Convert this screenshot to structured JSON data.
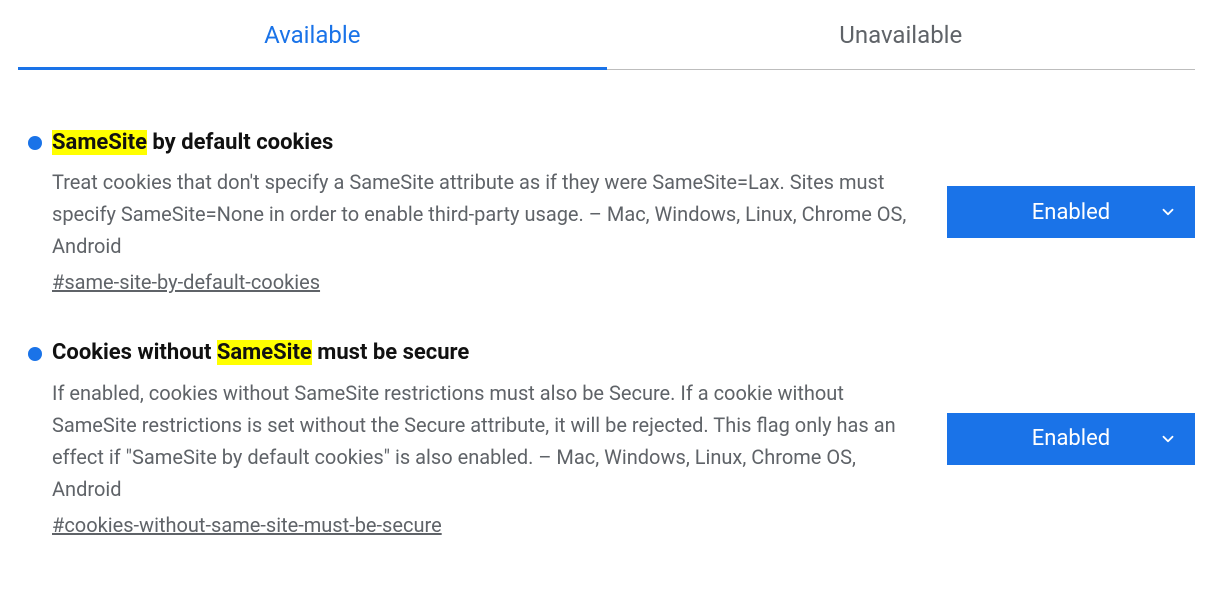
{
  "tabs": {
    "available": "Available",
    "unavailable": "Unavailable"
  },
  "highlight": "SameSite",
  "flags": [
    {
      "title_before": "",
      "title_highlight": "SameSite",
      "title_after": " by default cookies",
      "description": "Treat cookies that don't specify a SameSite attribute as if they were SameSite=Lax. Sites must specify SameSite=None in order to enable third-party usage. – Mac, Windows, Linux, Chrome OS, Android",
      "anchor": "#same-site-by-default-cookies",
      "value": "Enabled"
    },
    {
      "title_before": "Cookies without ",
      "title_highlight": "SameSite",
      "title_after": " must be secure",
      "description": "If enabled, cookies without SameSite restrictions must also be Secure. If a cookie without SameSite restrictions is set without the Secure attribute, it will be rejected. This flag only has an effect if \"SameSite by default cookies\" is also enabled. – Mac, Windows, Linux, Chrome OS, Android",
      "anchor": "#cookies-without-same-site-must-be-secure",
      "value": "Enabled"
    }
  ]
}
